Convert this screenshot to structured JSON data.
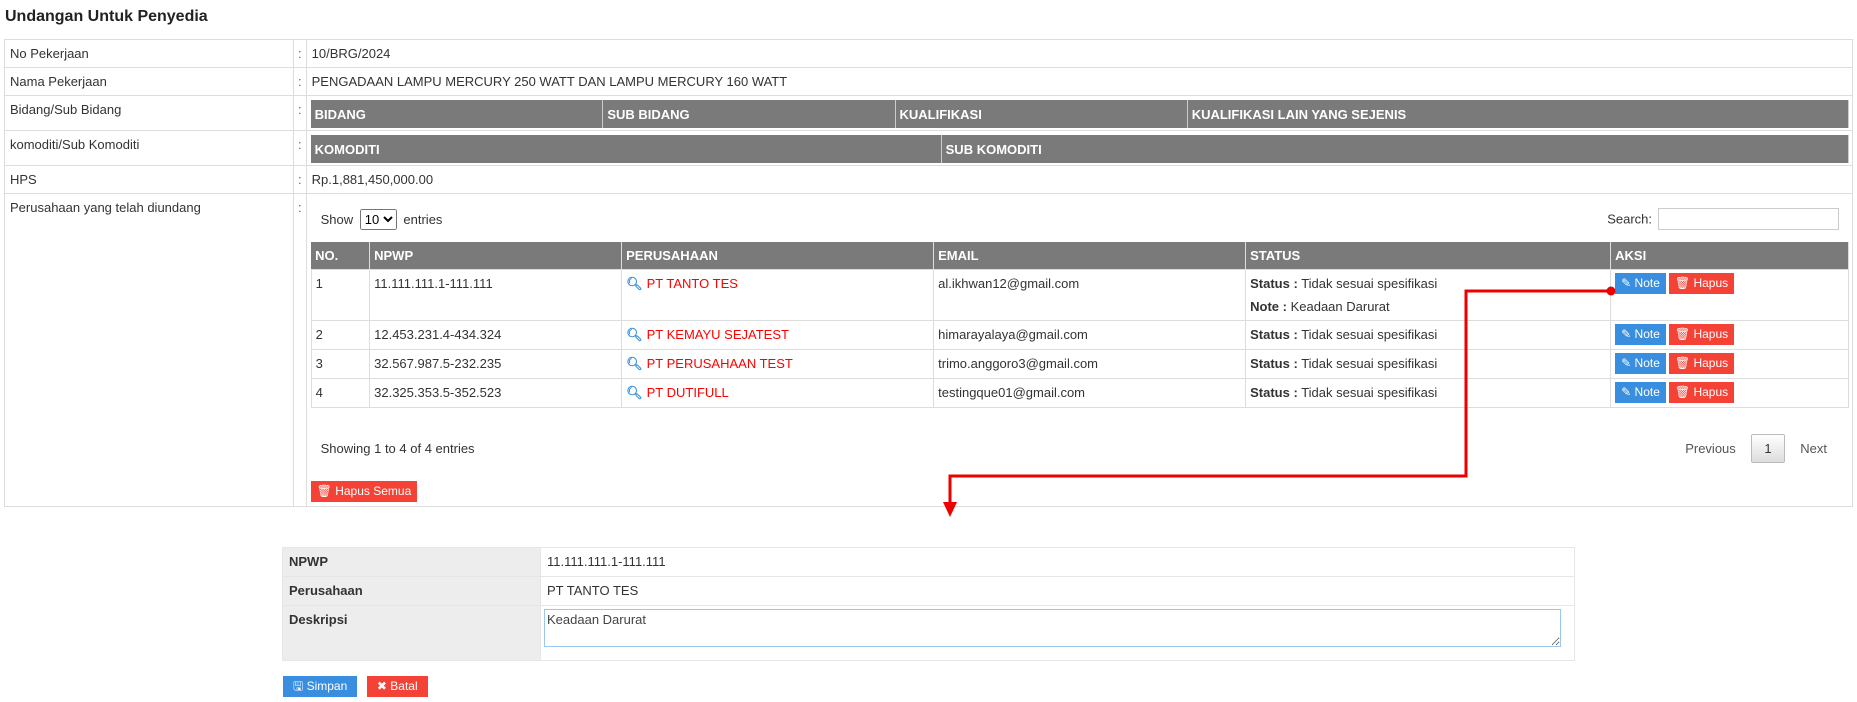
{
  "title": "Undangan Untuk Penyedia",
  "fields": {
    "no_pekerjaan": {
      "label": "No Pekerjaan",
      "value": "10/BRG/2024"
    },
    "nama_pekerjaan": {
      "label": "Nama Pekerjaan",
      "value": "PENGADAAN LAMPU MERCURY 250 WATT DAN LAMPU MERCURY 160 WATT"
    },
    "bidang": {
      "label": "Bidang/Sub Bidang",
      "headers": [
        "BIDANG",
        "SUB BIDANG",
        "KUALIFIKASI",
        "KUALIFIKASI LAIN YANG SEJENIS"
      ]
    },
    "komoditi": {
      "label": "komoditi/Sub Komoditi",
      "headers": [
        "KOMODITI",
        "SUB KOMODITI"
      ]
    },
    "hps": {
      "label": "HPS",
      "value": "Rp.1,881,450,000.00"
    },
    "perusahaan": {
      "label": "Perusahaan yang telah diundang"
    },
    "colon": ":"
  },
  "datatable": {
    "show": "Show",
    "entries": "entries",
    "length": "10",
    "search_label": "Search:",
    "headers": [
      "NO.",
      "NPWP",
      "PERUSAHAAN",
      "EMAIL",
      "STATUS",
      "AKSI"
    ],
    "status_label": "Status :",
    "note_label": "Note :",
    "note_btn": "Note",
    "hapus_btn": "Hapus",
    "rows": [
      {
        "no": "1",
        "npwp": "11.111.111.1-111.111",
        "perusahaan": "PT TANTO TES",
        "email": "al.ikhwan12@gmail.com",
        "status": "Tidak sesuai spesifikasi",
        "note": "Keadaan Darurat"
      },
      {
        "no": "2",
        "npwp": "12.453.231.4-434.324",
        "perusahaan": "PT KEMAYU SEJATEST",
        "email": "himarayalaya@gmail.com",
        "status": "Tidak sesuai spesifikasi"
      },
      {
        "no": "3",
        "npwp": "32.567.987.5-232.235",
        "perusahaan": "PT PERUSAHAAN TEST",
        "email": "trimo.anggoro3@gmail.com",
        "status": "Tidak sesuai spesifikasi"
      },
      {
        "no": "4",
        "npwp": "32.325.353.5-352.523",
        "perusahaan": "PT DUTIFULL",
        "email": "testingque01@gmail.com",
        "status": "Tidak sesuai spesifikasi"
      }
    ],
    "info": "Showing 1 to 4 of 4 entries",
    "prev": "Previous",
    "page": "1",
    "next": "Next",
    "hapus_semua": "Hapus Semua"
  },
  "form": {
    "npwp_label": "NPWP",
    "npwp": "11.111.111.1-111.111",
    "perusahaan_label": "Perusahaan",
    "perusahaan": "PT TANTO TES",
    "deskripsi_label": "Deskripsi",
    "deskripsi": "Keadaan Darurat",
    "simpan": "Simpan",
    "batal": "Batal"
  },
  "colors": {
    "header": "#7a7a7a",
    "primary": "#3a8ee0",
    "danger": "#f44336",
    "arrow": "#ee0000"
  },
  "icons": {
    "search": "magnifier-icon",
    "note": "edit-icon",
    "hapus": "trash-icon",
    "simpan": "save-icon",
    "batal": "close-icon"
  }
}
